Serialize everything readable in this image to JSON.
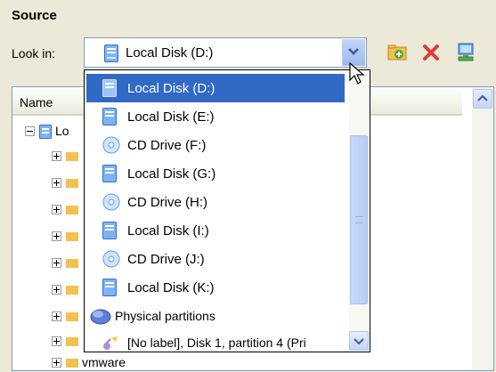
{
  "section": {
    "title": "Source"
  },
  "look_in": {
    "label": "Look in:",
    "selected_value": "Local Disk (D:)",
    "selected_icon": "local-disk-icon"
  },
  "toolbar": {
    "buttons": [
      {
        "name": "new-folder-button",
        "icon": "new-folder-icon"
      },
      {
        "name": "delete-button",
        "icon": "delete-x-icon"
      },
      {
        "name": "computer-button",
        "icon": "computer-icon"
      }
    ]
  },
  "tree": {
    "column_header": "Name",
    "root_label": "Lo",
    "last_child_label": "vmware"
  },
  "dropdown": {
    "items": [
      {
        "label": "Local Disk (D:)",
        "icon": "local-disk-icon",
        "selected": true
      },
      {
        "label": "Local Disk (E:)",
        "icon": "local-disk-icon"
      },
      {
        "label": "CD Drive (F:)",
        "icon": "cd-drive-icon"
      },
      {
        "label": "Local Disk (G:)",
        "icon": "local-disk-icon"
      },
      {
        "label": "CD Drive (H:)",
        "icon": "cd-drive-icon"
      },
      {
        "label": "Local Disk (I:)",
        "icon": "local-disk-icon"
      },
      {
        "label": "CD Drive (J:)",
        "icon": "cd-drive-icon"
      },
      {
        "label": "Local Disk (K:)",
        "icon": "local-disk-icon"
      },
      {
        "label": "Physical partitions",
        "icon": "physical-partitions-icon"
      },
      {
        "label": "[No label], Disk 1, partition 4 (Pri",
        "icon": "partition-icon"
      }
    ]
  },
  "colors": {
    "selection": "#316AC5",
    "window_bg": "#ECE9D8",
    "border": "#7F9DB9"
  }
}
